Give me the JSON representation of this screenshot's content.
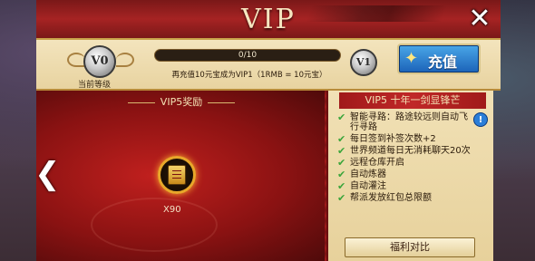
{
  "title": "VIP",
  "current_level": {
    "badge": "V0",
    "label": "当前等级"
  },
  "next_level": {
    "badge": "V1"
  },
  "progress": {
    "text": "0/10",
    "fraction": 0.0
  },
  "hint": "再充值10元宝成为VIP1（1RMB = 10元宝）",
  "recharge_label": "充值",
  "reward": {
    "header": "VIP5奖励",
    "quantity": "X90",
    "icon": "scroll-icon"
  },
  "perks": {
    "header": "VIP5 十年一剑显锋芒",
    "items": [
      "智能寻路：路途较远则自动飞行寻路",
      "每日签到补签次数+2",
      "世界频道每日无消耗聊天20次",
      "远程仓库开启",
      "自动炼器",
      "自动灌注",
      "帮派发放红包总限额"
    ]
  },
  "compare_label": "福利对比",
  "icons": {
    "close": "close-icon",
    "prev": "chevron-left-icon",
    "info": "info-icon",
    "check": "check-icon"
  },
  "colors": {
    "accent_red": "#a62323",
    "gold": "#c8a24a",
    "recharge_blue": "#2b7ed8",
    "check_green": "#3aa53a"
  }
}
